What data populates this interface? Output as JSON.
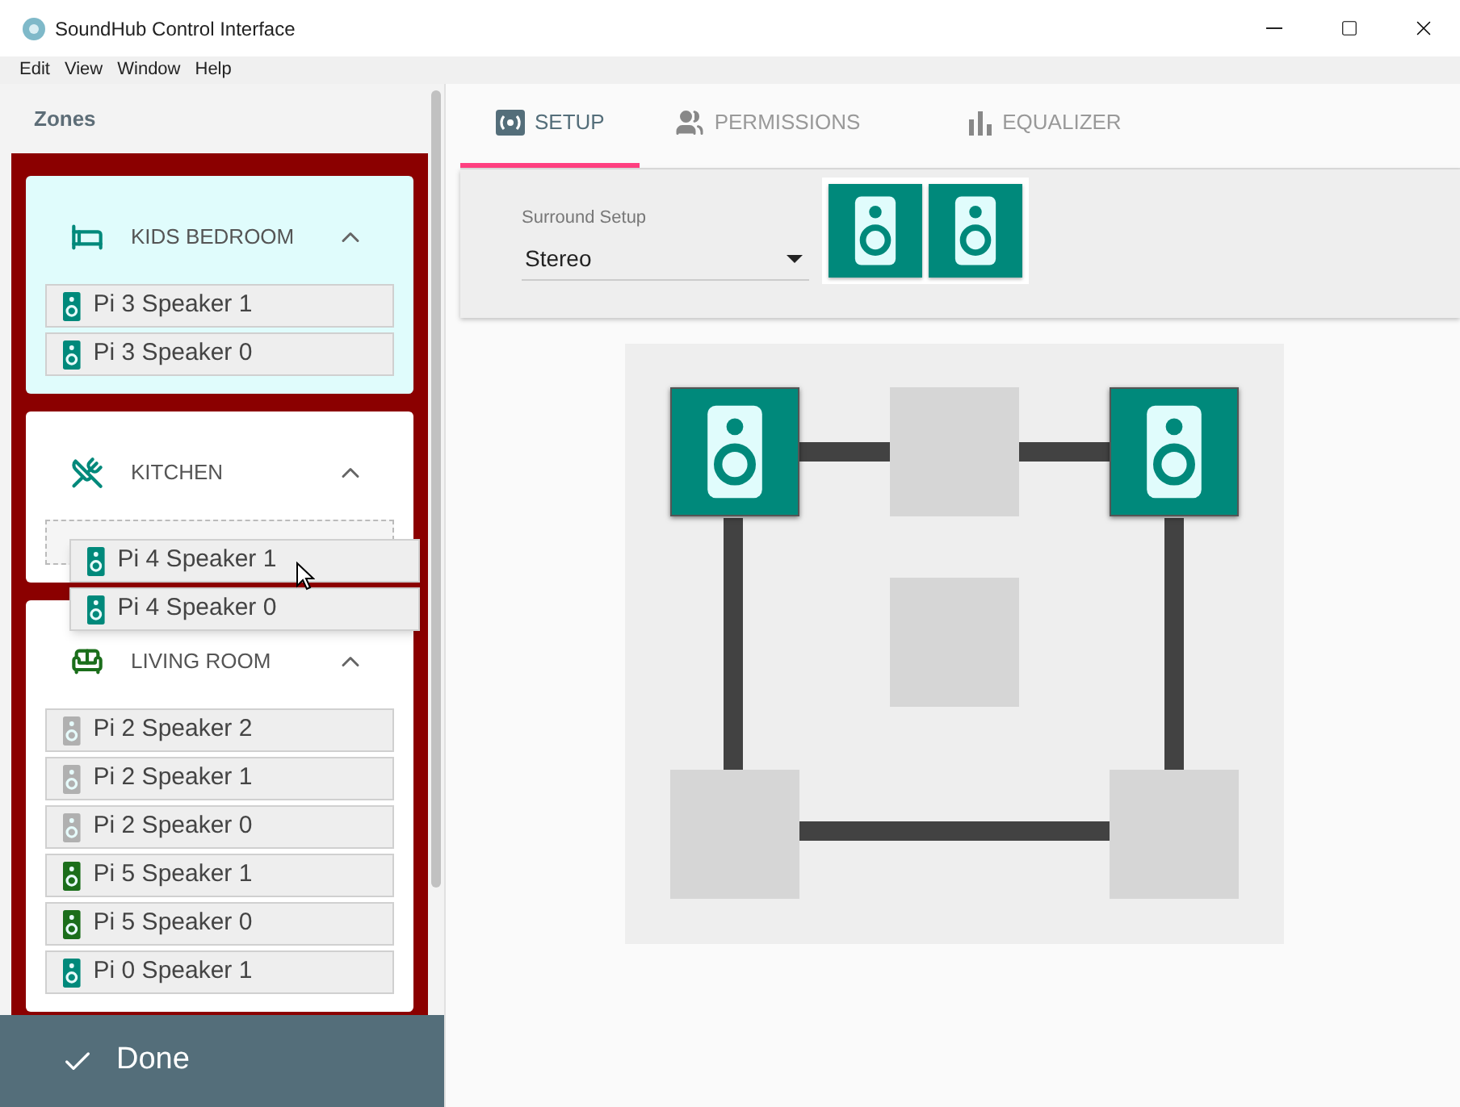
{
  "window": {
    "title": "SoundHub Control Interface"
  },
  "menu": [
    "Edit",
    "View",
    "Window",
    "Help"
  ],
  "sidebar": {
    "title": "Zones",
    "zones": [
      {
        "name": "KIDS BEDROOM",
        "kind": "bedroom",
        "color": "#00897b",
        "highlighted": true,
        "expanded": true,
        "drop_placeholder": false,
        "speakers": [
          {
            "name": "Pi 3 Speaker 1",
            "color": "#00897b"
          },
          {
            "name": "Pi 3 Speaker 0",
            "color": "#00897b"
          }
        ]
      },
      {
        "name": "KITCHEN",
        "kind": "kitchen",
        "color": "#00897b",
        "highlighted": false,
        "expanded": true,
        "drop_placeholder": true
      },
      {
        "name": "LIVING ROOM",
        "kind": "living",
        "color": "#1b6e1b",
        "highlighted": false,
        "expanded": true,
        "drop_placeholder": false,
        "speakers": [
          {
            "name": "Pi 2 Speaker 2",
            "color": "#b0b0b0"
          },
          {
            "name": "Pi 2 Speaker 1",
            "color": "#b0b0b0"
          },
          {
            "name": "Pi 2 Speaker 0",
            "color": "#b0b0b0"
          },
          {
            "name": "Pi 5 Speaker 1",
            "color": "#1b6e1b"
          },
          {
            "name": "Pi 5 Speaker 0",
            "color": "#1b6e1b"
          },
          {
            "name": "Pi 0 Speaker 1",
            "color": "#00897b"
          }
        ]
      }
    ],
    "dragged_speakers": [
      {
        "name": "Pi 4 Speaker 1",
        "color": "#00897b"
      },
      {
        "name": "Pi 4 Speaker 0",
        "color": "#00897b"
      }
    ],
    "done_button": "Done"
  },
  "tabs": [
    {
      "label": "SETUP",
      "kind": "setup",
      "selected": true
    },
    {
      "label": "PERMISSIONS",
      "kind": "people",
      "selected": false
    },
    {
      "label": "EQUALIZER",
      "kind": "equalizer",
      "selected": false
    }
  ],
  "setup": {
    "surround_label": "Surround Setup",
    "surround_value": "Stereo",
    "tray": [
      {
        "kind": "speaker"
      },
      {
        "kind": "speaker"
      }
    ],
    "slots": [
      {
        "filled": true
      },
      {
        "filled": false
      },
      {
        "filled": true
      },
      {
        "filled": false
      },
      {
        "filled": false
      },
      {
        "filled": false
      }
    ]
  }
}
